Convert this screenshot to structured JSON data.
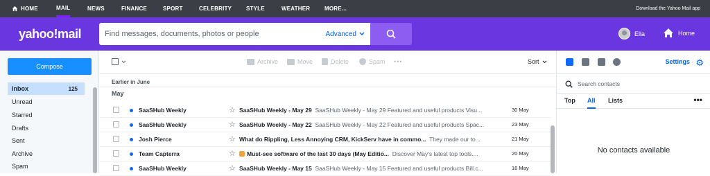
{
  "topnav": {
    "items": [
      {
        "label": "HOME",
        "icon": "home-icon"
      },
      {
        "label": "MAIL"
      },
      {
        "label": "NEWS"
      },
      {
        "label": "FINANCE"
      },
      {
        "label": "SPORT"
      },
      {
        "label": "CELEBRITY"
      },
      {
        "label": "STYLE"
      },
      {
        "label": "WEATHER"
      },
      {
        "label": "MORE..."
      }
    ],
    "active": "MAIL",
    "promo": "Download the Yahoo Mail app"
  },
  "header": {
    "logo": "yahoo!mail",
    "search_placeholder": "Find messages, documents, photos or people",
    "advanced": "Advanced",
    "user": "Ella",
    "home": "Home",
    "brand_color": "#6a36e0"
  },
  "sidebar": {
    "compose": "Compose",
    "folders": [
      {
        "label": "Inbox",
        "count": "125"
      },
      {
        "label": "Unread"
      },
      {
        "label": "Starred"
      },
      {
        "label": "Drafts"
      },
      {
        "label": "Sent"
      },
      {
        "label": "Archive"
      },
      {
        "label": "Spam"
      }
    ]
  },
  "toolbar": {
    "archive": "Archive",
    "move": "Move",
    "delete": "Delete",
    "spam": "Spam",
    "more": "•••",
    "sort": "Sort"
  },
  "list": {
    "section": "Earlier in June",
    "subsection": "May",
    "rows": [
      {
        "from": "SaaSHub Weekly",
        "subject": "SaaSHub Weekly - May 29",
        "preview": "SaaSHub Weekly - May 29 Featured and useful products Visu...",
        "date": "30 May"
      },
      {
        "from": "SaaSHub Weekly",
        "subject": "SaaSHub Weekly - May 22",
        "preview": "SaaSHub Weekly - May 22 Featured and useful products Spac...",
        "date": "23 May"
      },
      {
        "from": "Josh Pierce",
        "subject": "What do Rippling, Less Annoying CRM, KickServ have in commo...",
        "preview": "They made our to...",
        "date": "21 May"
      },
      {
        "from": "Team Capterra",
        "subject": "Must-see software of the last 30 days (May Editio...",
        "preview": "Discover May's latest top tools....",
        "date": "20 May",
        "trophy": true
      },
      {
        "from": "SaaSHub Weekly",
        "subject": "SaaSHub Weekly - May 15",
        "preview": "SaaSHub Weekly - May 15 Featured and useful products Bill.c...",
        "date": "16 May"
      }
    ]
  },
  "right": {
    "settings": "Settings",
    "search_placeholder": "Search contacts",
    "tabs": [
      "Top",
      "All",
      "Lists"
    ],
    "active_tab": "All",
    "more": "•••",
    "empty": "No contacts available"
  }
}
